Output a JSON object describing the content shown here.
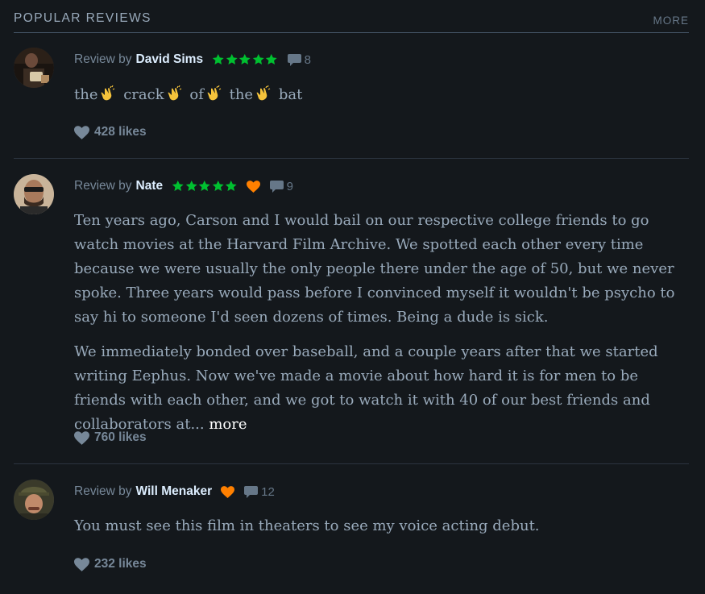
{
  "section": {
    "title": "POPULAR REVIEWS",
    "more_label": "MORE"
  },
  "colors": {
    "background": "#14181c",
    "star": "#00c030",
    "heart_like": "#ff8000",
    "text": "#99aabb",
    "author": "#ddeeff"
  },
  "reviews": [
    {
      "by_label": "Review by",
      "author": "David Sims",
      "stars": 5,
      "liked": false,
      "comments": "8",
      "paragraph1_words": [
        "the",
        "crack",
        "of",
        "the",
        "bat"
      ],
      "emoji_icon": "clapping-hands-icon",
      "likes": "428 likes"
    },
    {
      "by_label": "Review by",
      "author": "Nate",
      "stars": 5,
      "liked": true,
      "comments": "9",
      "paragraph1": "Ten years ago, Carson and I would bail on our respective college friends to go watch movies at the Harvard Film Archive. We spotted each other every time because we were usually the only people there under the age of 50, but we never spoke. Three years would pass before I convinced myself it wouldn't be psycho to say hi to someone I'd seen dozens of times. Being a dude is sick.",
      "paragraph2": "We immediately bonded over baseball, and a couple years after that we started writing Eephus. Now we've made a movie about how hard it is for men to be friends with each other, and we got to watch it with 40 of our best friends and collaborators at...",
      "more_label": "more",
      "likes": "760 likes"
    },
    {
      "by_label": "Review by",
      "author": "Will Menaker",
      "stars": 0,
      "liked": true,
      "comments": "12",
      "paragraph1": "You must see this film in theaters to see my voice acting debut.",
      "likes": "232 likes"
    }
  ]
}
